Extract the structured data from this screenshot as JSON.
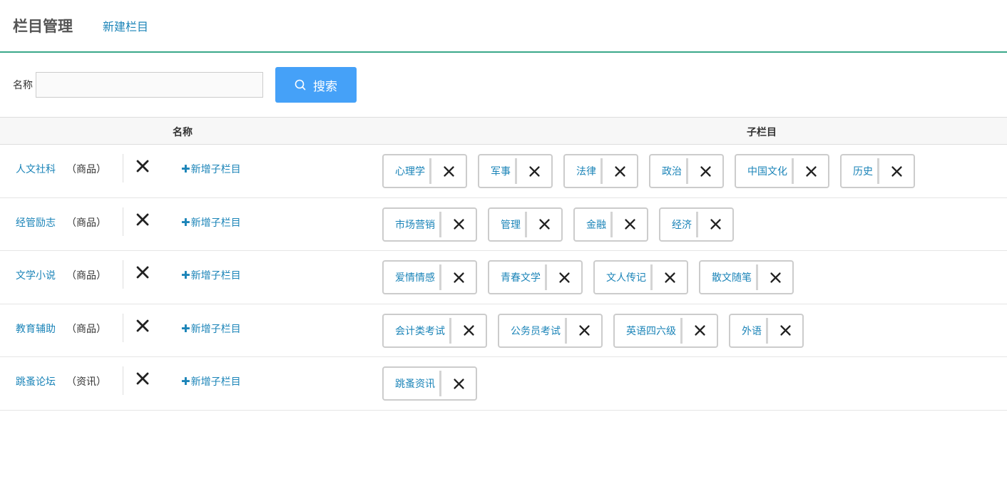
{
  "header": {
    "title": "栏目管理",
    "new_link": "新建栏目"
  },
  "search": {
    "label": "名称",
    "value": "",
    "placeholder": "",
    "button_label": "搜索"
  },
  "table": {
    "columns": [
      "名称",
      "子栏目"
    ],
    "add_sub_label": "新增子栏目",
    "rows": [
      {
        "name": "人文社科",
        "type": "（商品）",
        "children": [
          "心理学",
          "军事",
          "法律",
          "政治",
          "中国文化",
          "历史"
        ]
      },
      {
        "name": "经管励志",
        "type": "（商品）",
        "children": [
          "市场营销",
          "管理",
          "金融",
          "经济"
        ]
      },
      {
        "name": "文学小说",
        "type": "（商品）",
        "children": [
          "爱情情感",
          "青春文学",
          "文人传记",
          "散文随笔"
        ]
      },
      {
        "name": "教育辅助",
        "type": "（商品）",
        "children": [
          "会计类考试",
          "公务员考试",
          "英语四六级",
          "外语"
        ]
      },
      {
        "name": "跳蚤论坛",
        "type": "（资讯）",
        "children": [
          "跳蚤资讯"
        ]
      }
    ]
  },
  "colors": {
    "accent": "#3aa889",
    "link": "#1b84b8",
    "button": "#45a1f8"
  },
  "icons": {
    "delete": "close-icon",
    "search": "search-icon",
    "add": "plus-icon"
  }
}
